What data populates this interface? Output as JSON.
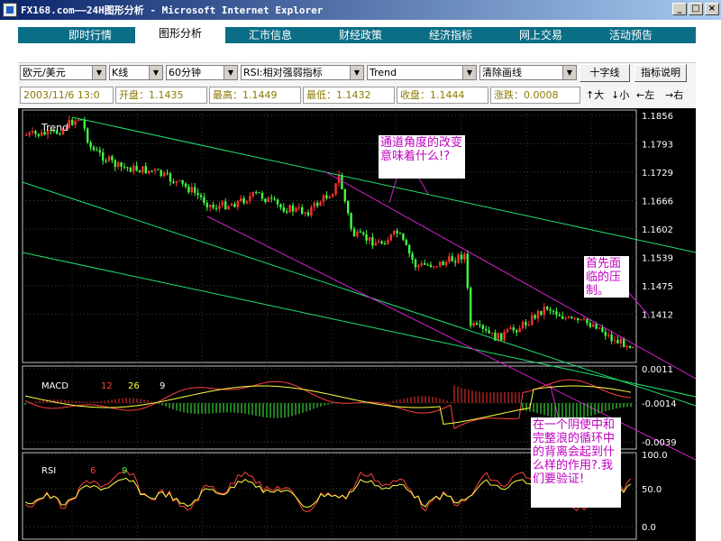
{
  "window": {
    "title": "FX168.com——24H图形分析 - Microsoft Internet Explorer",
    "controls": [
      "_",
      "□",
      "×"
    ]
  },
  "tabs": [
    {
      "label": "即时行情",
      "active": false
    },
    {
      "label": "图形分析",
      "active": true
    },
    {
      "label": "汇市信息",
      "active": false
    },
    {
      "label": "财经政策",
      "active": false
    },
    {
      "label": "经济指标",
      "active": false
    },
    {
      "label": "网上交易",
      "active": false
    },
    {
      "label": "活动预告",
      "active": false
    }
  ],
  "toolbar": {
    "symbol": "欧元/美元",
    "chart_type": "K线",
    "period": "60分钟",
    "indicator": "RSI:相对强弱指标",
    "drawing": "Trend",
    "clear": "清除画线",
    "crosshair_label": "十字线",
    "indicator_help_label": "指标说明"
  },
  "quote": {
    "datetime": "2003/11/6 13:0",
    "open": "开盘：1.1435",
    "high": "最高：1.1449",
    "low": "最低：1.1432",
    "close": "收盘：1.1444",
    "change": "涨跌：0.0008"
  },
  "nav": {
    "zoom_in": "↑大",
    "zoom_out": "↓小",
    "left": "←左",
    "right": "→右"
  },
  "chart": {
    "main_label": "Trend",
    "price_ticks": [
      "1.1856",
      "1.1793",
      "1.1729",
      "1.1666",
      "1.1602",
      "1.1539",
      "1.1475",
      "1.1412"
    ],
    "macd_label": "MACD",
    "macd_params": [
      "12",
      "26",
      "9"
    ],
    "macd_ticks": [
      "0.0011",
      "-0.0014",
      "-0.0039"
    ],
    "rsi_label": "RSI",
    "rsi_params": [
      "6",
      "9"
    ],
    "rsi_ticks": [
      "100.0",
      "50.0",
      "0.0"
    ],
    "colors": {
      "up": "#ff3030",
      "down": "#40ff40",
      "channel": "#20e070",
      "annotation": "#d020d0",
      "axis_text": "#ffffff",
      "macd_line": "#ff4040",
      "signal_line": "#ffff40"
    }
  },
  "annotations": {
    "note1": "通道角度的改变意味着什么!?",
    "note2": "首先面临的压制。",
    "note3": "在一个阴使中和完整浪的循环中的背离会起到什么样的作用?.我们要验证!"
  }
}
